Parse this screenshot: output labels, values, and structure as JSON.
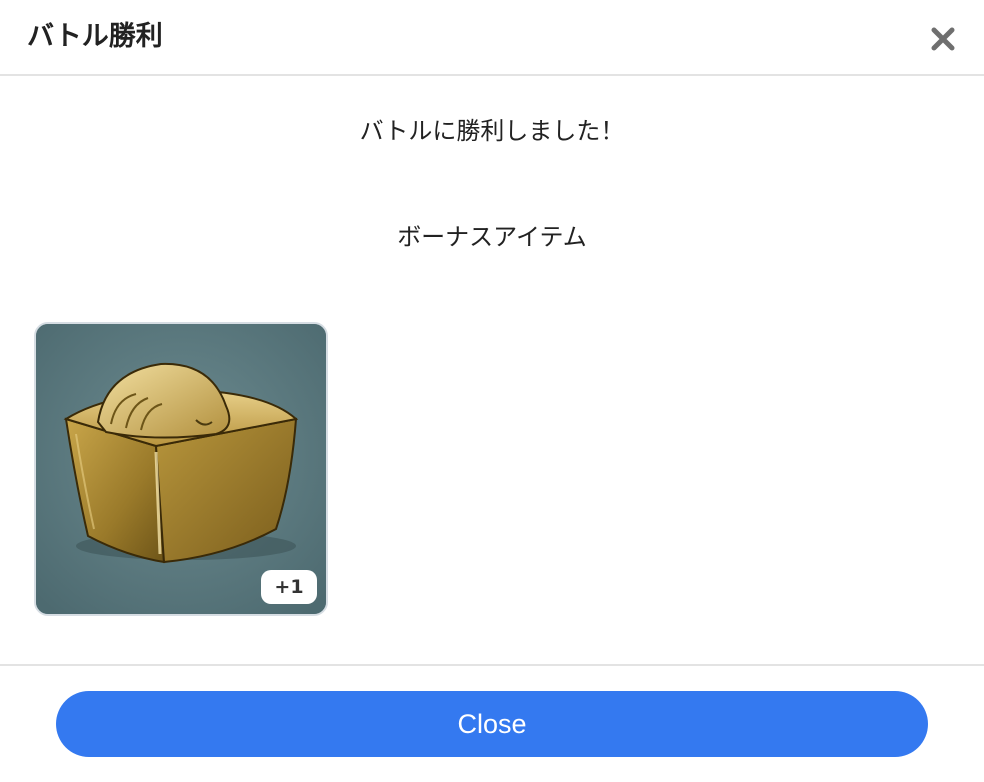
{
  "dialog": {
    "title": "バトル勝利",
    "close_icon": "close-icon"
  },
  "body": {
    "message": "バトルに勝利しました！",
    "bonus_heading": "ボーナスアイテム",
    "items": [
      {
        "icon": "gold-block-item-image",
        "quantity": "+1"
      }
    ]
  },
  "footer": {
    "close_label": "Close"
  },
  "colors": {
    "primary_button": "#3479f0",
    "item_background": "#5b7a80",
    "divider": "#e3e3e3"
  }
}
